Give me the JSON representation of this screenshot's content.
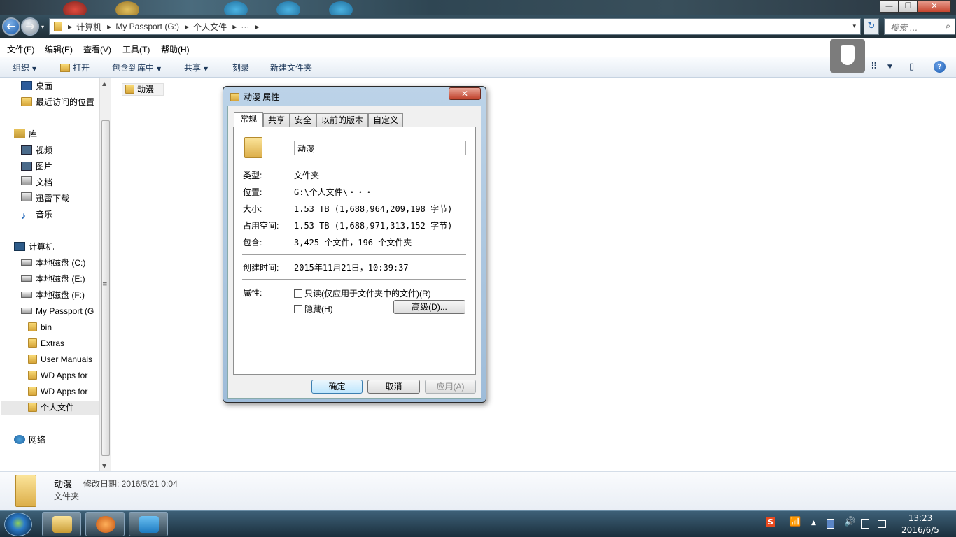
{
  "window": {
    "minimize": "—",
    "maximize": "❐",
    "close": "✕"
  },
  "nav": {
    "back": "←",
    "forward": "→",
    "dropdown": "▾",
    "crumbs": [
      "计算机",
      "My Passport (G:)",
      "个人文件",
      "···"
    ],
    "addr_dropdown": "▾",
    "refresh": "↻",
    "search_placeholder": "搜索 ...",
    "search_icon": "⌕"
  },
  "menu": [
    "文件(F)",
    "编辑(E)",
    "查看(V)",
    "工具(T)",
    "帮助(H)"
  ],
  "toolbar": {
    "organize": "组织",
    "open": "打开",
    "include_library": "包含到库中",
    "share": "共享",
    "burn": "刻录",
    "new_folder": "新建文件夹",
    "dd": "▼",
    "view_icon": "⠿",
    "pane_icon": "▯",
    "help": "?"
  },
  "sidebar": {
    "desktop": "桌面",
    "recent": "最近访问的位置",
    "library": "库",
    "videos": "视频",
    "pictures": "图片",
    "documents": "文档",
    "xunlei": "迅雷下载",
    "music": "音乐",
    "computer": "计算机",
    "drive_c": "本地磁盘 (C:)",
    "drive_e": "本地磁盘 (E:)",
    "drive_f": "本地磁盘 (F:)",
    "drive_g": "My Passport (G",
    "bin": "bin",
    "extras": "Extras",
    "manuals": "User Manuals",
    "wd1": "WD Apps for",
    "wd2": "WD Apps for",
    "personal": "个人文件",
    "network": "网络"
  },
  "scroll": {
    "up": "▲",
    "down": "▼",
    "grip": "≡"
  },
  "content": {
    "folder": "动漫"
  },
  "details": {
    "name": "动漫",
    "modified": "修改日期: 2016/5/21 0:04",
    "type": "文件夹"
  },
  "dialog": {
    "title": "动漫 属性",
    "close": "✕",
    "tabs": [
      "常规",
      "共享",
      "安全",
      "以前的版本",
      "自定义"
    ],
    "name_value": "动漫",
    "labels": {
      "type": "类型:",
      "location": "位置:",
      "size": "大小:",
      "disk": "占用空间:",
      "contains": "包含:",
      "created": "创建时间:",
      "attrs": "属性:"
    },
    "values": {
      "type": "文件夹",
      "location": "G:\\个人文件\\・・・",
      "size": "1.53 TB (1,688,964,209,198 字节)",
      "disk": "1.53 TB (1,688,971,313,152 字节)",
      "contains": "3,425 个文件，196 个文件夹",
      "created": "2015年11月21日，10:39:37"
    },
    "readonly": "只读(仅应用于文件夹中的文件)(R)",
    "hidden": "隐藏(H)",
    "advanced": "高级(D)...",
    "ok": "确定",
    "cancel": "取消",
    "apply": "应用(A)"
  },
  "tray": {
    "ime": "S",
    "wifi": "📶",
    "up": "▲",
    "vol": "🔊",
    "clock_time": "13:23",
    "clock_date": "2016/6/5"
  }
}
